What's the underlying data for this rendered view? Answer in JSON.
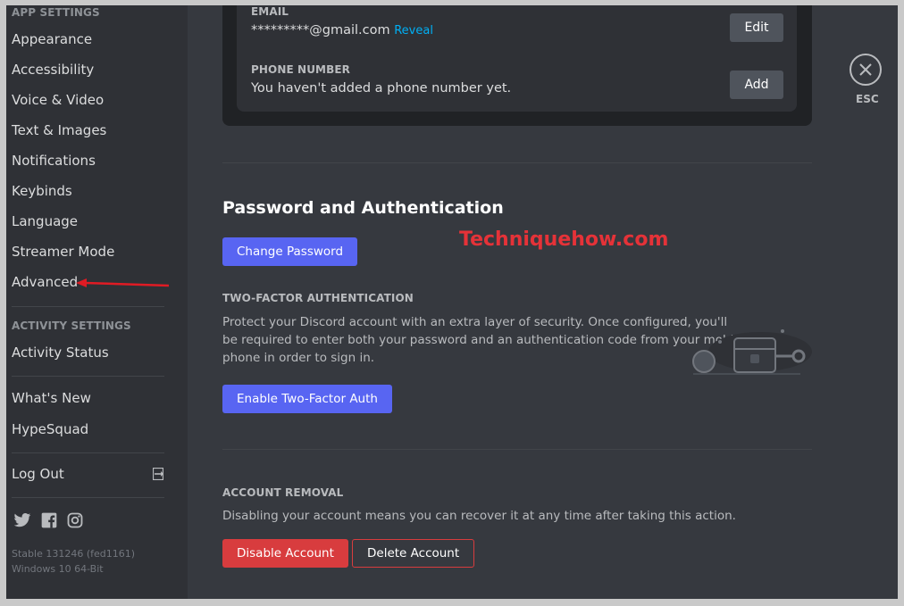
{
  "sidebar": {
    "app_settings_header": "APP SETTINGS",
    "app_items": [
      {
        "label": "Appearance"
      },
      {
        "label": "Accessibility"
      },
      {
        "label": "Voice & Video"
      },
      {
        "label": "Text & Images"
      },
      {
        "label": "Notifications"
      },
      {
        "label": "Keybinds"
      },
      {
        "label": "Language"
      },
      {
        "label": "Streamer Mode"
      },
      {
        "label": "Advanced"
      }
    ],
    "activity_settings_header": "ACTIVITY SETTINGS",
    "activity_items": [
      {
        "label": "Activity Status"
      }
    ],
    "misc_items": [
      {
        "label": "What's New"
      },
      {
        "label": "HypeSquad"
      }
    ],
    "logout_label": "Log Out",
    "version_line1": "Stable 131246 (fed1161)",
    "version_line2": "Windows 10 64-Bit"
  },
  "account_card": {
    "email_label": "EMAIL",
    "email_value": "*********@gmail.com",
    "reveal_label": "Reveal",
    "edit_label": "Edit",
    "phone_label": "PHONE NUMBER",
    "phone_value": "You haven't added a phone number yet.",
    "add_label": "Add"
  },
  "password_auth": {
    "title": "Password and Authentication",
    "change_password_label": "Change Password",
    "two_factor_header": "TWO-FACTOR AUTHENTICATION",
    "two_factor_desc_line1": "Protect your Discord account with an extra layer of security. Once configured, you'll",
    "two_factor_desc_line2": "be required to enter both your password and an authentication code from your mobile",
    "two_factor_desc_line3": "phone in order to sign in.",
    "enable_2fa_label": "Enable Two-Factor Auth"
  },
  "account_removal": {
    "header": "ACCOUNT REMOVAL",
    "desc": "Disabling your account means you can recover it at any time after taking this action.",
    "disable_label": "Disable Account",
    "delete_label": "Delete Account"
  },
  "watermark": "Techniquehow.com",
  "esc_label": "ESC",
  "colors": {
    "blurple": "#5865f2",
    "danger": "#d83c3e",
    "link": "#00aff4",
    "watermark": "#e53238"
  },
  "icons": {
    "logout": "logout-icon",
    "twitter": "twitter-icon",
    "facebook": "facebook-icon",
    "instagram": "instagram-icon",
    "close": "close-icon"
  }
}
